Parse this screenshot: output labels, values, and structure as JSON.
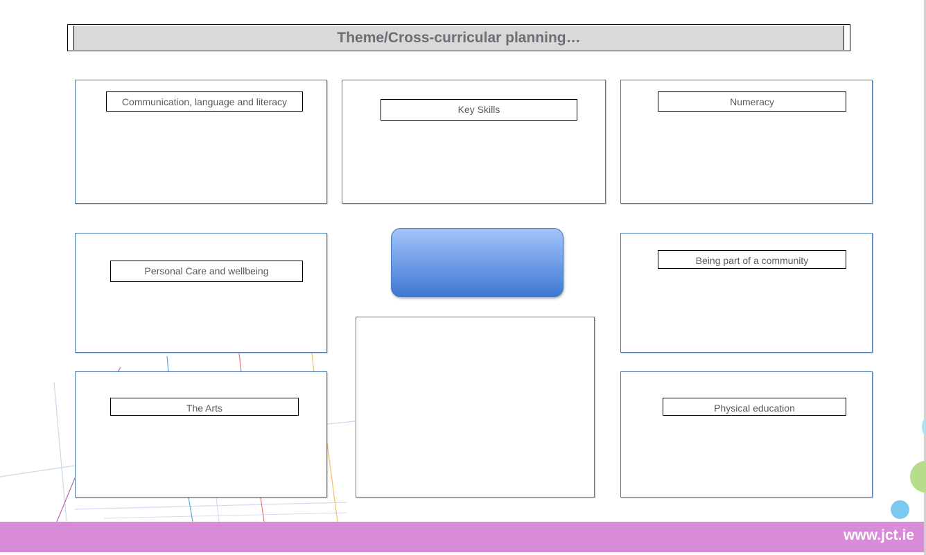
{
  "title": "Theme/Cross-curricular planning…",
  "panels": {
    "communication": "Communication, language and literacy",
    "key_skills": "Key Skills",
    "numeracy": "Numeracy",
    "personal_care": "Personal Care and wellbeing",
    "community": "Being part of a community",
    "arts": "The Arts",
    "physical_education": "Physical education"
  },
  "footer": {
    "url": "www.jct.ie"
  },
  "colors": {
    "footer_bg": "#d88cd8",
    "panel_border": "#4a7ab0",
    "center_top": "#a3c4fb",
    "center_bottom": "#3d78d2",
    "title_bg": "#d9d9d9"
  }
}
